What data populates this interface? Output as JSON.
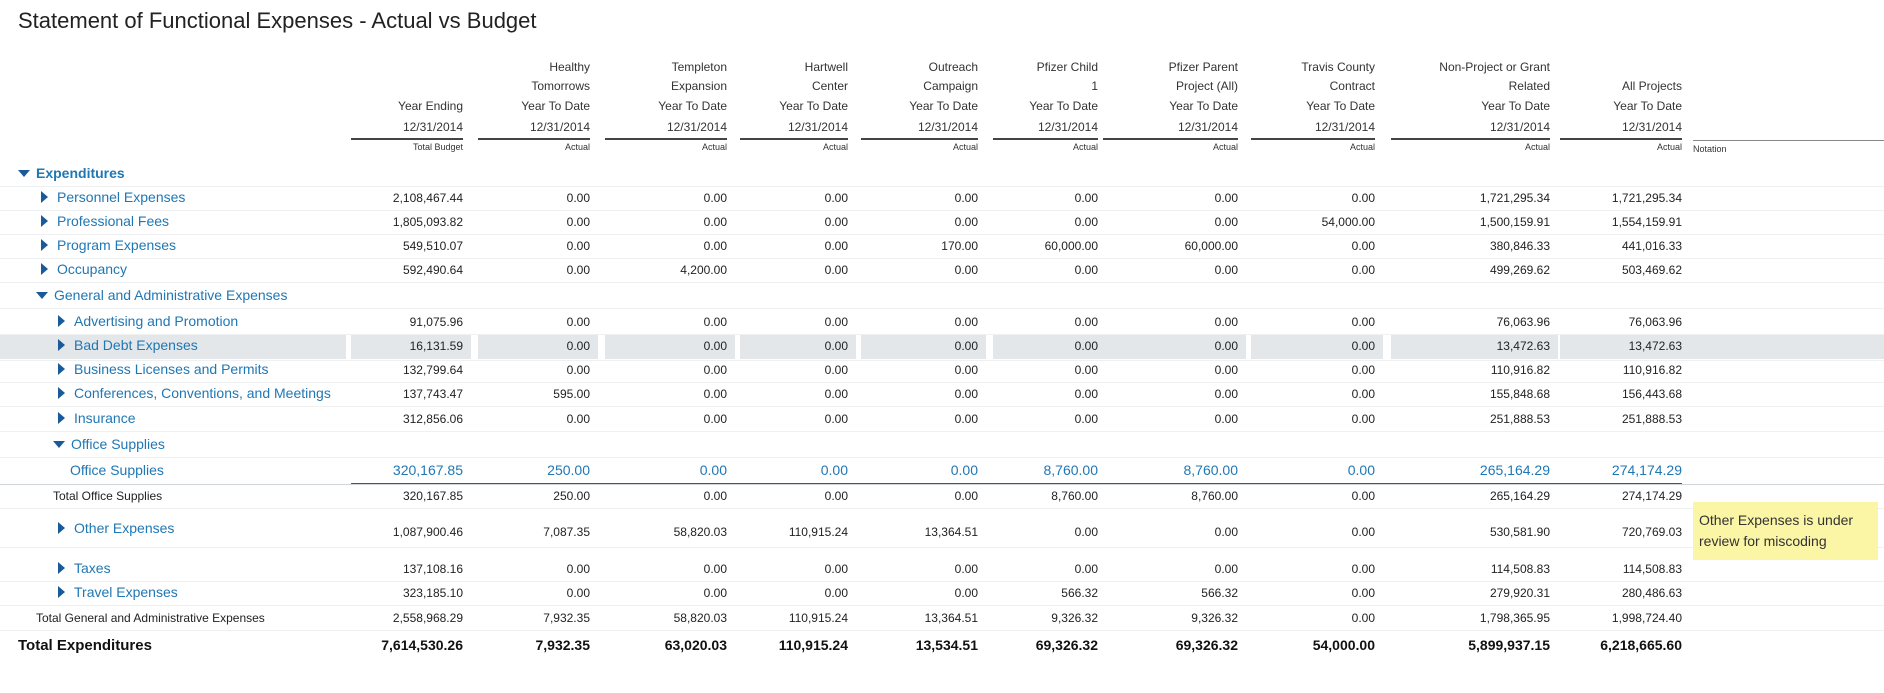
{
  "title": "Statement of Functional Expenses - Actual vs Budget",
  "columns": [
    {
      "h1": "",
      "h2": "",
      "h3": "Year Ending",
      "h4": "12/31/2014",
      "sub": "Total Budget"
    },
    {
      "h1": "Healthy",
      "h2": "Tomorrows",
      "h3": "Year To Date",
      "h4": "12/31/2014",
      "sub": "Actual"
    },
    {
      "h1": "Templeton",
      "h2": "Expansion",
      "h3": "Year To Date",
      "h4": "12/31/2014",
      "sub": "Actual"
    },
    {
      "h1": "Hartwell",
      "h2": "Center",
      "h3": "Year To Date",
      "h4": "12/31/2014",
      "sub": "Actual"
    },
    {
      "h1": "Outreach",
      "h2": "Campaign",
      "h3": "Year To Date",
      "h4": "12/31/2014",
      "sub": "Actual"
    },
    {
      "h1": "Pfizer Child",
      "h2": "1",
      "h3": "Year To Date",
      "h4": "12/31/2014",
      "sub": "Actual"
    },
    {
      "h1": "Pfizer Parent",
      "h2": "Project (All)",
      "h3": "Year To Date",
      "h4": "12/31/2014",
      "sub": "Actual"
    },
    {
      "h1": "Travis County",
      "h2": "Contract",
      "h3": "Year To Date",
      "h4": "12/31/2014",
      "sub": "Actual"
    },
    {
      "h1": "Non-Project or Grant",
      "h2": "Related",
      "h3": "Year To Date",
      "h4": "12/31/2014",
      "sub": "Actual"
    },
    {
      "h1": "",
      "h2": "All Projects",
      "h3": "Year To Date",
      "h4": "12/31/2014",
      "sub": "Actual"
    }
  ],
  "notation_header": "Notation",
  "rows": [
    {
      "label": "Expenditures",
      "values": []
    },
    {
      "label": "Personnel Expenses",
      "values": [
        "2,108,467.44",
        "0.00",
        "0.00",
        "0.00",
        "0.00",
        "0.00",
        "0.00",
        "0.00",
        "1,721,295.34",
        "1,721,295.34"
      ]
    },
    {
      "label": "Professional Fees",
      "values": [
        "1,805,093.82",
        "0.00",
        "0.00",
        "0.00",
        "0.00",
        "0.00",
        "0.00",
        "54,000.00",
        "1,500,159.91",
        "1,554,159.91"
      ]
    },
    {
      "label": "Program Expenses",
      "values": [
        "549,510.07",
        "0.00",
        "0.00",
        "0.00",
        "170.00",
        "60,000.00",
        "60,000.00",
        "0.00",
        "380,846.33",
        "441,016.33"
      ]
    },
    {
      "label": "Occupancy",
      "values": [
        "592,490.64",
        "0.00",
        "4,200.00",
        "0.00",
        "0.00",
        "0.00",
        "0.00",
        "0.00",
        "499,269.62",
        "503,469.62"
      ]
    },
    {
      "label": "General and Administrative Expenses",
      "values": []
    },
    {
      "label": "Advertising and Promotion",
      "values": [
        "91,075.96",
        "0.00",
        "0.00",
        "0.00",
        "0.00",
        "0.00",
        "0.00",
        "0.00",
        "76,063.96",
        "76,063.96"
      ]
    },
    {
      "label": "Bad Debt Expenses",
      "values": [
        "16,131.59",
        "0.00",
        "0.00",
        "0.00",
        "0.00",
        "0.00",
        "0.00",
        "0.00",
        "13,472.63",
        "13,472.63"
      ]
    },
    {
      "label": "Business Licenses and Permits",
      "values": [
        "132,799.64",
        "0.00",
        "0.00",
        "0.00",
        "0.00",
        "0.00",
        "0.00",
        "0.00",
        "110,916.82",
        "110,916.82"
      ]
    },
    {
      "label": "Conferences, Conventions, and Meetings",
      "values": [
        "137,743.47",
        "595.00",
        "0.00",
        "0.00",
        "0.00",
        "0.00",
        "0.00",
        "0.00",
        "155,848.68",
        "156,443.68"
      ]
    },
    {
      "label": "Insurance",
      "values": [
        "312,856.06",
        "0.00",
        "0.00",
        "0.00",
        "0.00",
        "0.00",
        "0.00",
        "0.00",
        "251,888.53",
        "251,888.53"
      ]
    },
    {
      "label": "Office Supplies",
      "values": []
    },
    {
      "label": "Office Supplies",
      "values": [
        "320,167.85",
        "250.00",
        "0.00",
        "0.00",
        "0.00",
        "8,760.00",
        "8,760.00",
        "0.00",
        "265,164.29",
        "274,174.29"
      ]
    },
    {
      "label": "Total Office Supplies",
      "values": [
        "320,167.85",
        "250.00",
        "0.00",
        "0.00",
        "0.00",
        "8,760.00",
        "8,760.00",
        "0.00",
        "265,164.29",
        "274,174.29"
      ]
    },
    {
      "label": "Other Expenses",
      "values": [
        "1,087,900.46",
        "7,087.35",
        "58,820.03",
        "110,915.24",
        "13,364.51",
        "0.00",
        "0.00",
        "0.00",
        "530,581.90",
        "720,769.03"
      ]
    },
    {
      "label": "Taxes",
      "values": [
        "137,108.16",
        "0.00",
        "0.00",
        "0.00",
        "0.00",
        "0.00",
        "0.00",
        "0.00",
        "114,508.83",
        "114,508.83"
      ]
    },
    {
      "label": "Travel Expenses",
      "values": [
        "323,185.10",
        "0.00",
        "0.00",
        "0.00",
        "0.00",
        "566.32",
        "566.32",
        "0.00",
        "279,920.31",
        "280,486.63"
      ]
    },
    {
      "label": "Total General and Administrative Expenses",
      "values": [
        "2,558,968.29",
        "7,932.35",
        "58,820.03",
        "110,915.24",
        "13,364.51",
        "9,326.32",
        "9,326.32",
        "0.00",
        "1,798,365.95",
        "1,998,724.40"
      ]
    },
    {
      "label": "Total Expenditures",
      "values": [
        "7,614,530.26",
        "7,932.35",
        "63,020.03",
        "110,915.24",
        "13,534.51",
        "69,326.32",
        "69,326.32",
        "54,000.00",
        "5,899,937.15",
        "6,218,665.60"
      ]
    }
  ],
  "note": "Other Expenses is under review for miscoding"
}
